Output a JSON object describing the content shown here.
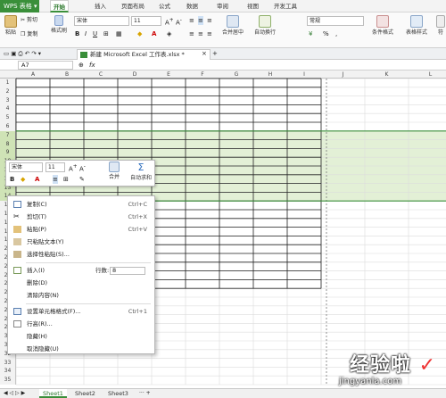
{
  "app": {
    "name": "WPS 表格"
  },
  "menu": {
    "tabs": [
      "开始",
      "插入",
      "页面布局",
      "公式",
      "数据",
      "审阅",
      "视图",
      "开发工具"
    ]
  },
  "ribbon": {
    "paste": "粘贴",
    "cut": "剪切",
    "copy": "复制",
    "format_painter": "格式刷",
    "font_name": "宋体",
    "font_size": "11",
    "merge_center": "合并居中",
    "auto_wrap": "自动换行",
    "number_format": "常规",
    "percent": "%",
    "comma": ",",
    "conditional_format": "条件格式",
    "table_style": "表格样式",
    "more": "符"
  },
  "doc": {
    "tab_title": "新建 Microsoft Excel 工作表.xlsx *"
  },
  "formula": {
    "cell_ref": "A7",
    "fx": "fx"
  },
  "grid": {
    "columns": [
      "A",
      "B",
      "C",
      "D",
      "E",
      "F",
      "G",
      "H",
      "I",
      "J",
      "K",
      "L"
    ],
    "rows": [
      "1",
      "2",
      "3",
      "4",
      "5",
      "6",
      "7",
      "8",
      "9",
      "10",
      "11",
      "12",
      "13",
      "14",
      "15",
      "16",
      "17",
      "18",
      "19",
      "20",
      "21",
      "22",
      "23",
      "24",
      "25",
      "26",
      "27",
      "28",
      "29",
      "30",
      "31",
      "32",
      "33",
      "34",
      "35"
    ]
  },
  "mini_toolbar": {
    "font_name": "宋体",
    "font_size": "11",
    "merge": "合并",
    "auto_sum": "自动求和"
  },
  "context_menu": {
    "copy": "复制(C)",
    "copy_sc": "Ctrl+C",
    "cut": "剪切(T)",
    "cut_sc": "Ctrl+X",
    "paste": "粘贴(P)",
    "paste_sc": "Ctrl+V",
    "paste_text": "只粘贴文本(Y)",
    "paste_special": "选择性粘贴(S)...",
    "insert": "插入(I)",
    "rows_label": "行数:",
    "rows_value": "8",
    "delete": "删除(D)",
    "clear": "清除内容(N)",
    "format_cells": "设置单元格格式(F)...",
    "format_sc": "Ctrl+1",
    "row_height": "行高(R)...",
    "hide": "隐藏(H)",
    "unhide": "取消隐藏(U)"
  },
  "sheets": [
    "Sheet1",
    "Sheet2",
    "Sheet3"
  ],
  "colors": {
    "accent": "#3a8f3a",
    "selection": "#e3f0d6",
    "header_sel": "#cfe3b6"
  }
}
